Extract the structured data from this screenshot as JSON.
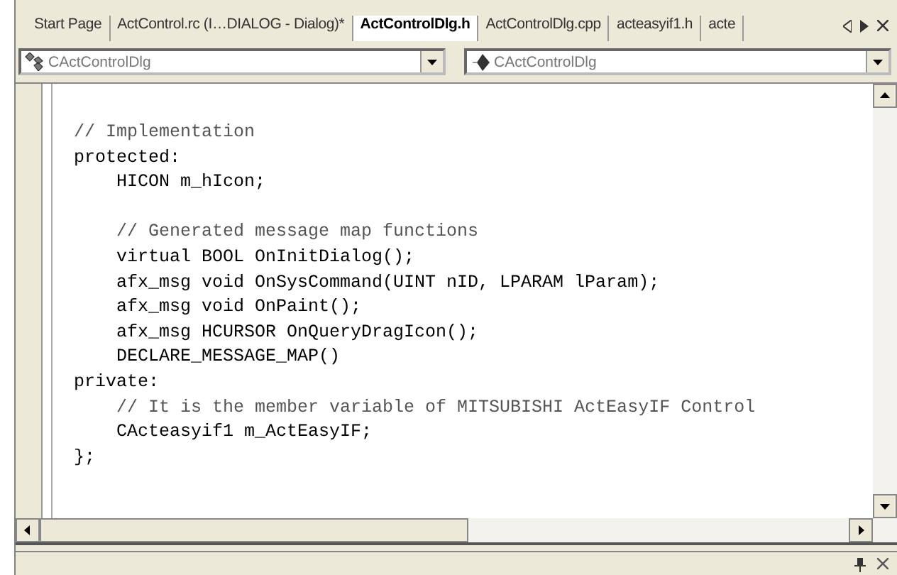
{
  "tabs": [
    {
      "label": "Start Page",
      "selected": false
    },
    {
      "label": "ActControl.rc (I…DIALOG - Dialog)*",
      "selected": false
    },
    {
      "label": "ActControlDlg.h",
      "selected": true
    },
    {
      "label": "ActControlDlg.cpp",
      "selected": false
    },
    {
      "label": "acteasyif1.h",
      "selected": false
    },
    {
      "label": "acte",
      "selected": false
    }
  ],
  "class_combo": {
    "value": "CActControlDlg"
  },
  "member_combo": {
    "value": "CActControlDlg"
  },
  "code_lines": [
    {
      "kind": "comment",
      "text": "// Implementation"
    },
    {
      "kind": "code",
      "text": "protected:"
    },
    {
      "kind": "code",
      "text": "    HICON m_hIcon;"
    },
    {
      "kind": "blank"
    },
    {
      "kind": "comment",
      "text": "    // Generated message map functions"
    },
    {
      "kind": "code",
      "text": "    virtual BOOL OnInitDialog();"
    },
    {
      "kind": "code",
      "text": "    afx_msg void OnSysCommand(UINT nID, LPARAM lParam);"
    },
    {
      "kind": "code",
      "text": "    afx_msg void OnPaint();"
    },
    {
      "kind": "code",
      "text": "    afx_msg HCURSOR OnQueryDragIcon();"
    },
    {
      "kind": "code",
      "text": "    DECLARE_MESSAGE_MAP()"
    },
    {
      "kind": "code",
      "text": "private:"
    },
    {
      "kind": "comment",
      "text": "    // It is the member variable of MITSUBISHI ActEasyIF Control"
    },
    {
      "kind": "code",
      "text": "    CActeasyif1 m_ActEasyIF;"
    },
    {
      "kind": "code",
      "text": "};"
    }
  ]
}
